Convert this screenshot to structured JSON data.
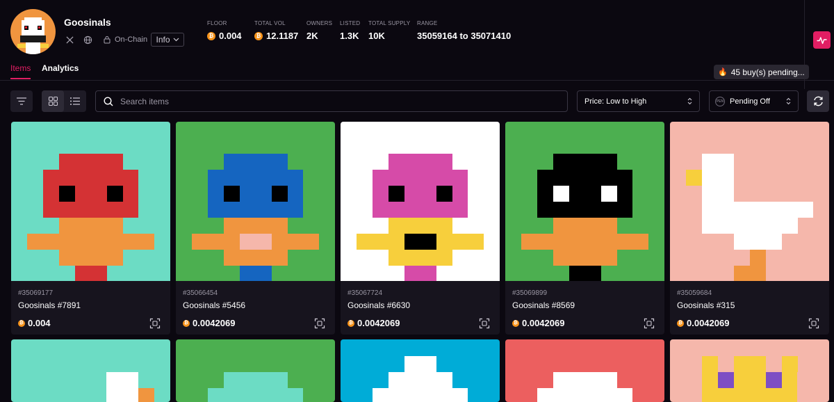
{
  "collection": {
    "name": "Goosinals",
    "onchain_label": "On-Chain",
    "info_label": "Info"
  },
  "stats": [
    {
      "label": "FLOOR",
      "value": "0.004",
      "btc": true
    },
    {
      "label": "TOTAL VOL",
      "value": "12.1187",
      "btc": true
    },
    {
      "label": "OWNERS",
      "value": "2K",
      "btc": false
    },
    {
      "label": "LISTED",
      "value": "1.3K",
      "btc": false
    },
    {
      "label": "TOTAL SUPPLY",
      "value": "10K",
      "btc": false
    },
    {
      "label": "RANGE",
      "value": "35059164 to 35071410",
      "btc": false
    }
  ],
  "tabs": {
    "items": "Items",
    "analytics": "Analytics"
  },
  "pending_buys": "45 buy(s) pending...",
  "toolbar": {
    "search_placeholder": "Search items",
    "sort_label": "Price: Low to High",
    "pending_label": "Pending Off",
    "pending_icon_text": "PEN"
  },
  "items": [
    {
      "inscription": "#35069177",
      "name": "Goosinals #7891",
      "price": "0.004",
      "bg": "#6cdcc4",
      "head": "#d43234",
      "eye": "#000000",
      "beak": "#f0953f",
      "body": "#d43234",
      "variant": "duck"
    },
    {
      "inscription": "#35066454",
      "name": "Goosinals #5456",
      "price": "0.0042069",
      "bg": "#4caf50",
      "head": "#1565c0",
      "eye": "#000000",
      "beak": "#f0953f",
      "body": "#1565c0",
      "variant": "duck-tongue"
    },
    {
      "inscription": "#35067724",
      "name": "Goosinals #6630",
      "price": "0.0042069",
      "bg": "#ffffff",
      "head": "#d64ba8",
      "eye": "#000000",
      "beak": "#f7cf3c",
      "body": "#d64ba8",
      "variant": "duck-mouth"
    },
    {
      "inscription": "#35069899",
      "name": "Goosinals #8569",
      "price": "0.0042069",
      "bg": "#4caf50",
      "head": "#000000",
      "eye": "#ffffff",
      "beak": "#f0953f",
      "body": "#000000",
      "variant": "duck"
    },
    {
      "inscription": "#35059684",
      "name": "Goosinals #315",
      "price": "0.0042069",
      "bg": "#f5b7ab",
      "head": "#ffffff",
      "eye": "#ffffff",
      "beak": "#f7cf3c",
      "body": "#ffffff",
      "variant": "goose"
    }
  ],
  "row2_colors": [
    "#6cdcc4",
    "#4caf50",
    "#00acd7",
    "#ec5f5f",
    "#f5b7ab"
  ]
}
